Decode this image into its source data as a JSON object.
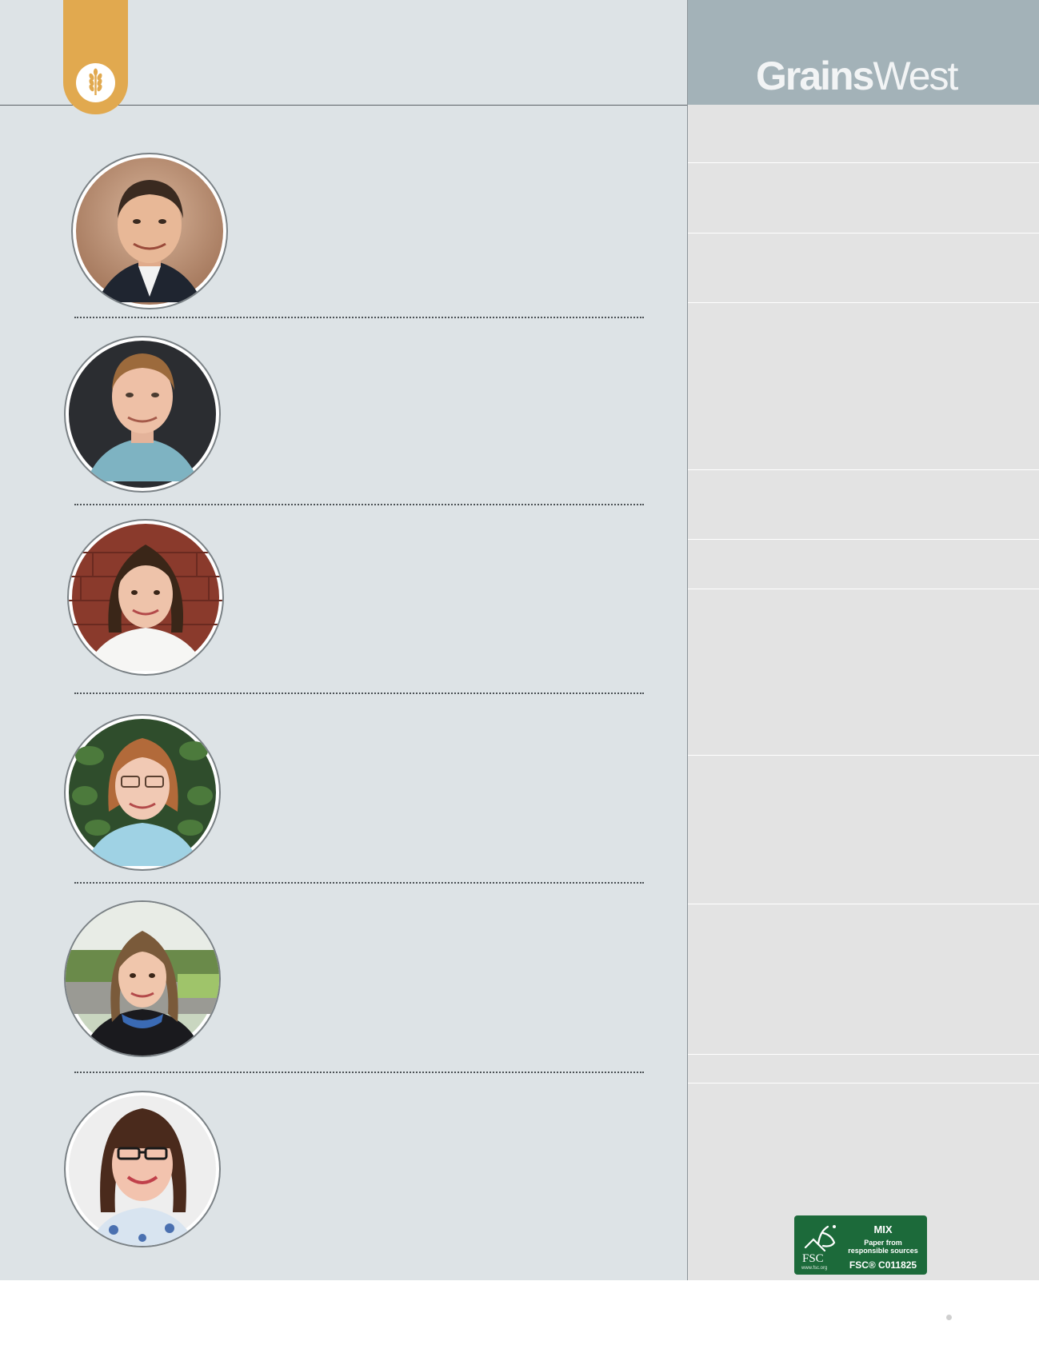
{
  "brand": {
    "name_bold": "Grains",
    "name_regular": "West",
    "accent_color": "#e1a94f",
    "header_color": "#a3b2b8"
  },
  "header_tab": {
    "icon": "wheat-icon"
  },
  "contributors": [
    {
      "photo": "portrait-1",
      "description": "man with dark hair in dark suit"
    },
    {
      "photo": "portrait-2",
      "description": "man in light blue shirt"
    },
    {
      "photo": "portrait-3",
      "description": "woman in front of brick wall"
    },
    {
      "photo": "portrait-4",
      "description": "woman with glasses in front of leaves"
    },
    {
      "photo": "portrait-5",
      "description": "woman outdoors in dark jacket"
    },
    {
      "photo": "portrait-6",
      "description": "woman with glasses and bangs"
    }
  ],
  "fsc_label": {
    "logo_text": "FSC",
    "url": "www.fsc.org",
    "mix": "MIX",
    "paper_line1": "Paper from",
    "paper_line2": "responsible sources",
    "code": "FSC® C011825",
    "color": "#1c6a3a"
  }
}
